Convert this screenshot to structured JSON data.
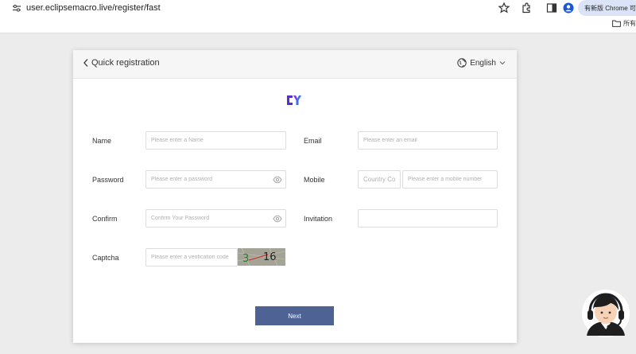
{
  "browser": {
    "url": "user.eclipsemacro.live/register/fast",
    "profile_label": "有新版 Chrome 可用",
    "bookmarks_folder": "所有"
  },
  "header": {
    "back_label": "Quick registration",
    "language": "English"
  },
  "form": {
    "name": {
      "label": "Name",
      "placeholder": "Please enter a Name"
    },
    "email": {
      "label": "Email",
      "placeholder": "Please enter an email"
    },
    "password": {
      "label": "Password",
      "placeholder": "Please enter a password"
    },
    "mobile": {
      "label": "Mobile",
      "country_placeholder": "Country Code",
      "placeholder": "Please enter a mobile number"
    },
    "confirm": {
      "label": "Confirm",
      "placeholder": "Confirm Your Password"
    },
    "invitation": {
      "label": "Invitation",
      "placeholder": ""
    },
    "captcha": {
      "label": "Captcha",
      "placeholder": "Please enter a verification code",
      "image_text": "3 16"
    },
    "next_label": "Next"
  },
  "colors": {
    "primary": "#4e6294",
    "logo_purple": "#5b2bd6",
    "logo_blue": "#3a6ff0"
  }
}
